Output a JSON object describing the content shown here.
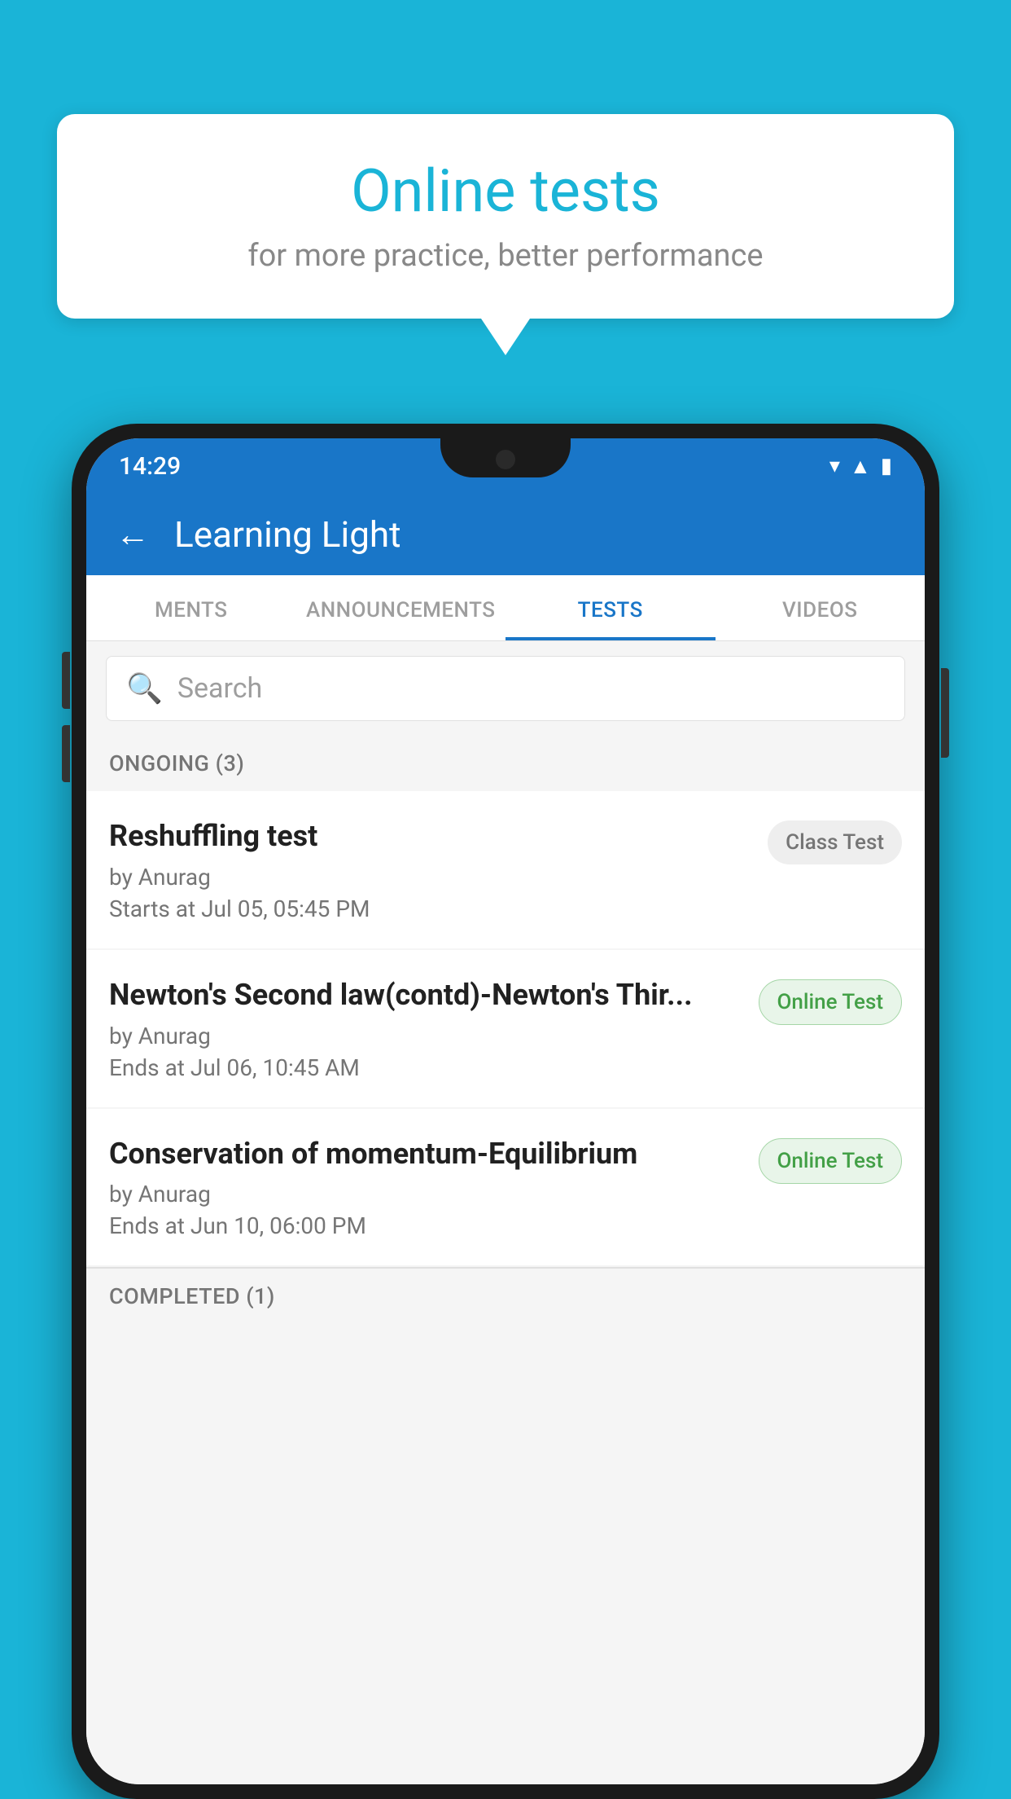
{
  "background": {
    "color": "#1ab4d7"
  },
  "speech_bubble": {
    "title": "Online tests",
    "subtitle": "for more practice, better performance"
  },
  "phone": {
    "status_bar": {
      "time": "14:29",
      "icons": [
        "wifi",
        "signal",
        "battery"
      ]
    },
    "app_bar": {
      "back_label": "←",
      "title": "Learning Light"
    },
    "tabs": [
      {
        "label": "MENTS",
        "active": false
      },
      {
        "label": "ANNOUNCEMENTS",
        "active": false
      },
      {
        "label": "TESTS",
        "active": true
      },
      {
        "label": "VIDEOS",
        "active": false
      }
    ],
    "search": {
      "placeholder": "Search"
    },
    "sections": [
      {
        "header": "ONGOING (3)",
        "tests": [
          {
            "name": "Reshuffling test",
            "author": "by Anurag",
            "date": "Starts at  Jul 05, 05:45 PM",
            "badge": "Class Test",
            "badge_type": "class"
          },
          {
            "name": "Newton's Second law(contd)-Newton's Thir...",
            "author": "by Anurag",
            "date": "Ends at  Jul 06, 10:45 AM",
            "badge": "Online Test",
            "badge_type": "online"
          },
          {
            "name": "Conservation of momentum-Equilibrium",
            "author": "by Anurag",
            "date": "Ends at  Jun 10, 06:00 PM",
            "badge": "Online Test",
            "badge_type": "online"
          }
        ]
      },
      {
        "header": "COMPLETED (1)",
        "tests": []
      }
    ]
  }
}
